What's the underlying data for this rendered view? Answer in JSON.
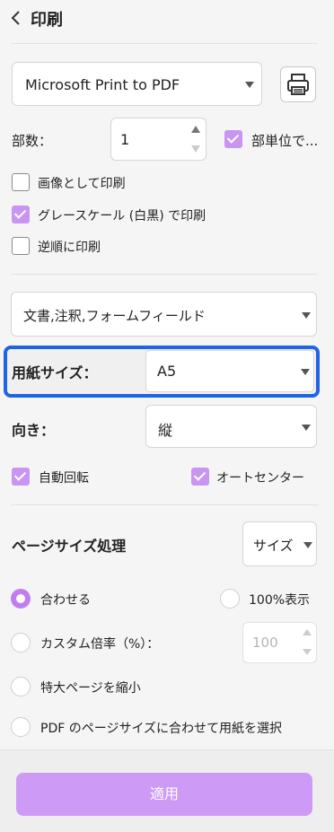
{
  "header": {
    "title": "印刷"
  },
  "printer": {
    "selected": "Microsoft Print to PDF"
  },
  "copies": {
    "label": "部数：",
    "value": "1",
    "collate_label": "部単位で..."
  },
  "options": {
    "as_image": "画像として印刷",
    "grayscale": "グレースケール (白黒) で印刷",
    "reverse": "逆順に印刷"
  },
  "content": {
    "selected": "文書,注釈,フォームフィールド"
  },
  "paper": {
    "label": "用紙サイズ：",
    "selected": "A5"
  },
  "orientation": {
    "label": "向き：",
    "selected": "縦"
  },
  "auto": {
    "rotate": "自動回転",
    "center": "オートセンター"
  },
  "page_sizing": {
    "title": "ページサイズ処理",
    "mode": "サイズ",
    "fit": "合わせる",
    "actual": "100%表示",
    "custom": "カスタム倍率（%）：",
    "custom_placeholder": "100",
    "shrink": "特大ページを縮小",
    "pdf_size": "PDF のページサイズに合わせて用紙を選択"
  },
  "apply_label": "適用",
  "colors": {
    "accent": "#c07ef0",
    "highlight": "#1e64e6",
    "button": "#cd9af5"
  }
}
